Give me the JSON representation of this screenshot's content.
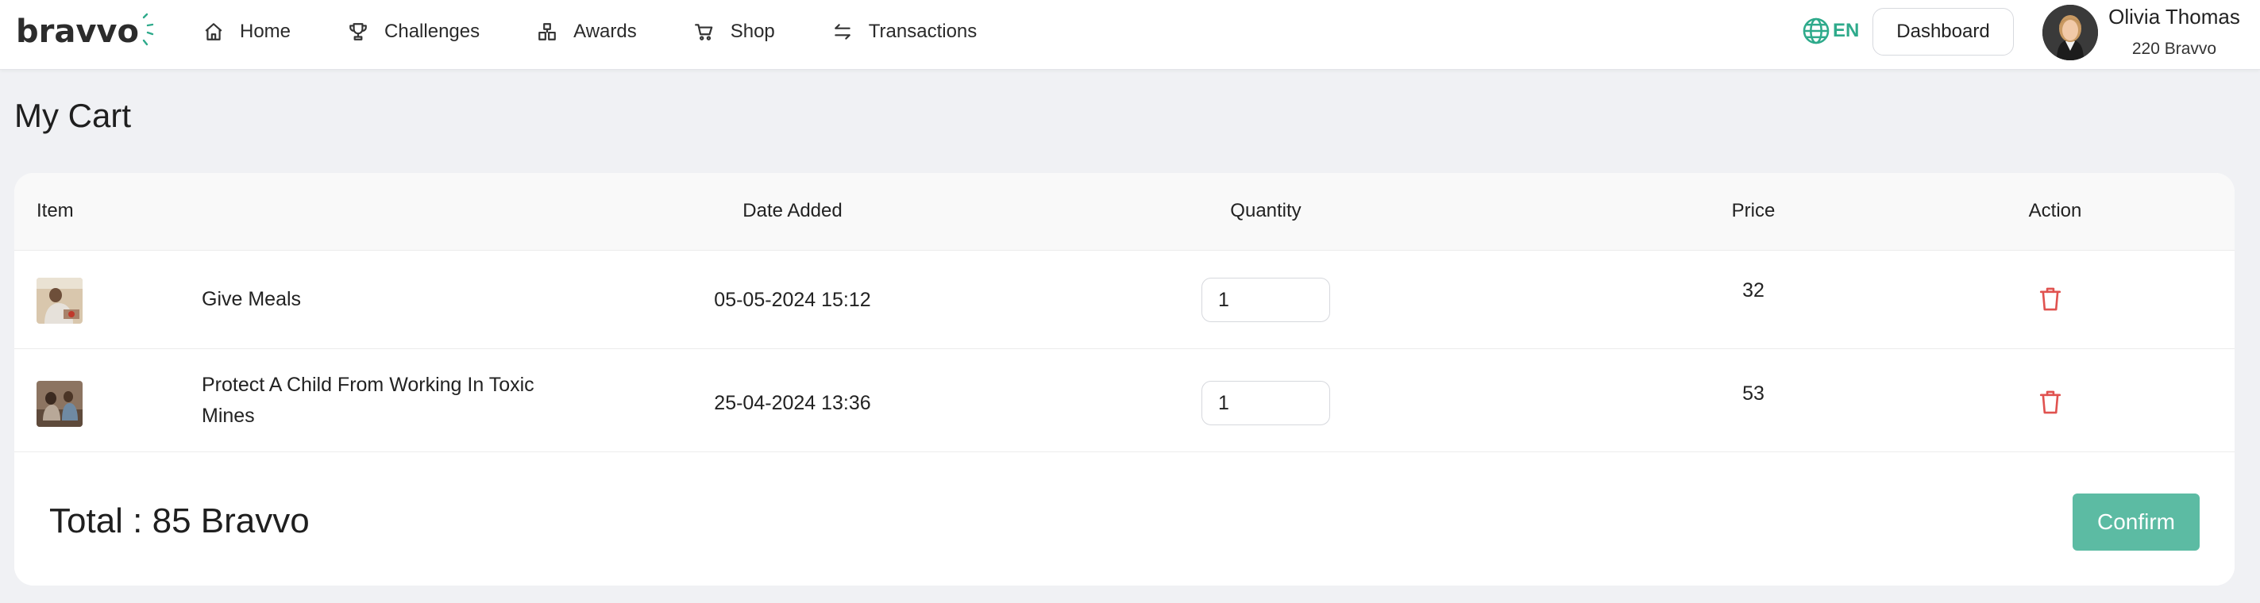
{
  "brand": {
    "name": "bravvo",
    "accent": "#2eaa8b"
  },
  "nav": {
    "items": [
      {
        "label": "Home",
        "icon": "home-icon"
      },
      {
        "label": "Challenges",
        "icon": "trophy-icon"
      },
      {
        "label": "Awards",
        "icon": "awards-icon"
      },
      {
        "label": "Shop",
        "icon": "cart-icon"
      },
      {
        "label": "Transactions",
        "icon": "transfer-icon"
      }
    ]
  },
  "header": {
    "language": "EN",
    "dashboard_label": "Dashboard",
    "user": {
      "name": "Olivia Thomas",
      "balance": "220 Bravvo"
    }
  },
  "page": {
    "title": "My Cart"
  },
  "cart": {
    "columns": [
      "Item",
      "Date Added",
      "Quantity",
      "Price",
      "Action"
    ],
    "rows": [
      {
        "name": "Give Meals",
        "date_added": "05-05-2024 15:12",
        "quantity": "1",
        "price": "32",
        "action_icon": "trash-icon"
      },
      {
        "name": "Protect A Child From Working In Toxic Mines",
        "date_added": "25-04-2024 13:36",
        "quantity": "1",
        "price": "53",
        "action_icon": "trash-icon"
      }
    ],
    "total_label": "Total : 85 Bravvo",
    "confirm_label": "Confirm"
  },
  "colors": {
    "confirm": "#5cbba3",
    "delete": "#e0524f",
    "background": "#f0f1f4"
  }
}
